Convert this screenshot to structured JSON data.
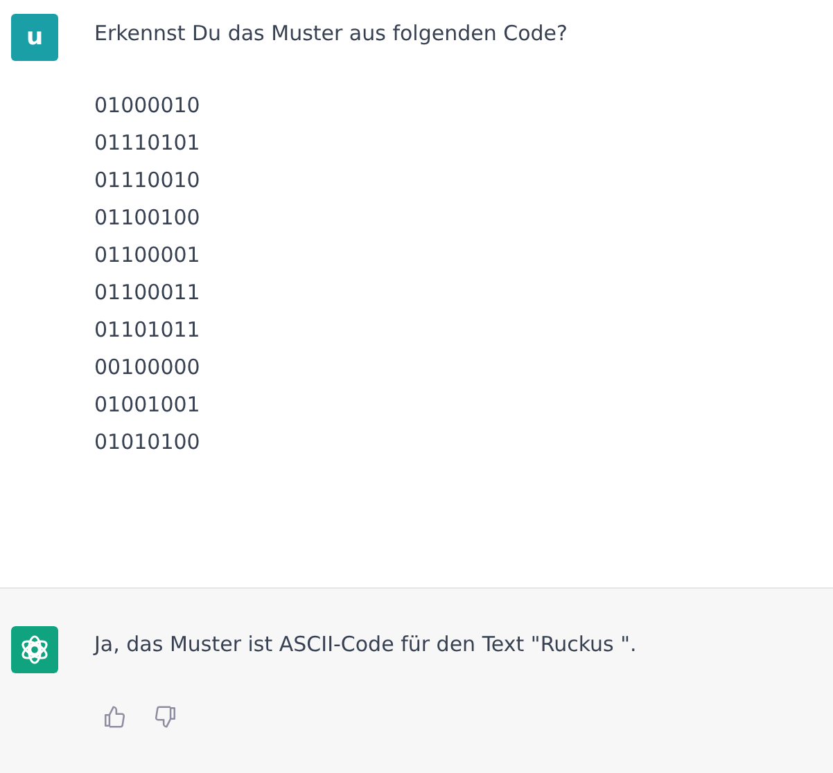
{
  "messages": [
    {
      "kind": "user",
      "avatar": "u",
      "text": "Erkennst Du das Muster aus folgenden Code?",
      "code_lines": [
        "01000010",
        "01110101",
        "01110010",
        "01100100",
        "01100001",
        "01100011",
        "01101011",
        "00100000",
        "01001001",
        "01010100"
      ]
    },
    {
      "kind": "assistant",
      "text": "Ja, das Muster ist ASCII-Code für den Text \"Ruckus \"."
    }
  ]
}
